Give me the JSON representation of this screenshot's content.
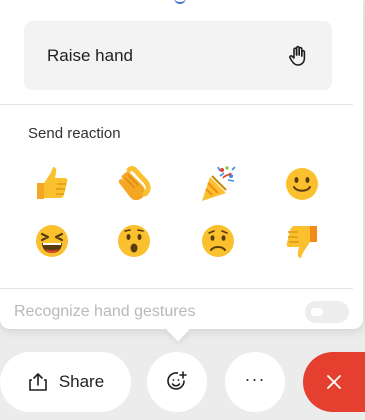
{
  "popover": {
    "raise_hand_label": "Raise hand",
    "send_reaction_title": "Send reaction",
    "reactions": [
      {
        "icon": "thumbs-up-emoji",
        "label": "👍"
      },
      {
        "icon": "clapping-hands-emoji",
        "label": "👏"
      },
      {
        "icon": "party-popper-emoji",
        "label": "🎉"
      },
      {
        "icon": "smiling-face-emoji",
        "label": "🙂"
      },
      {
        "icon": "laughing-face-emoji",
        "label": "😆"
      },
      {
        "icon": "surprised-face-emoji",
        "label": "😮"
      },
      {
        "icon": "sad-face-emoji",
        "label": "☹️"
      },
      {
        "icon": "thumbs-down-emoji",
        "label": "👎"
      }
    ],
    "gestures_label": "Recognize hand gestures",
    "gestures_enabled": false
  },
  "toolbar": {
    "share_label": "Share",
    "more_label": "···",
    "colors": {
      "end_button": "#e5402f",
      "emoji_yellow": "#fbc02d",
      "toggle_off": "#ededed"
    }
  }
}
